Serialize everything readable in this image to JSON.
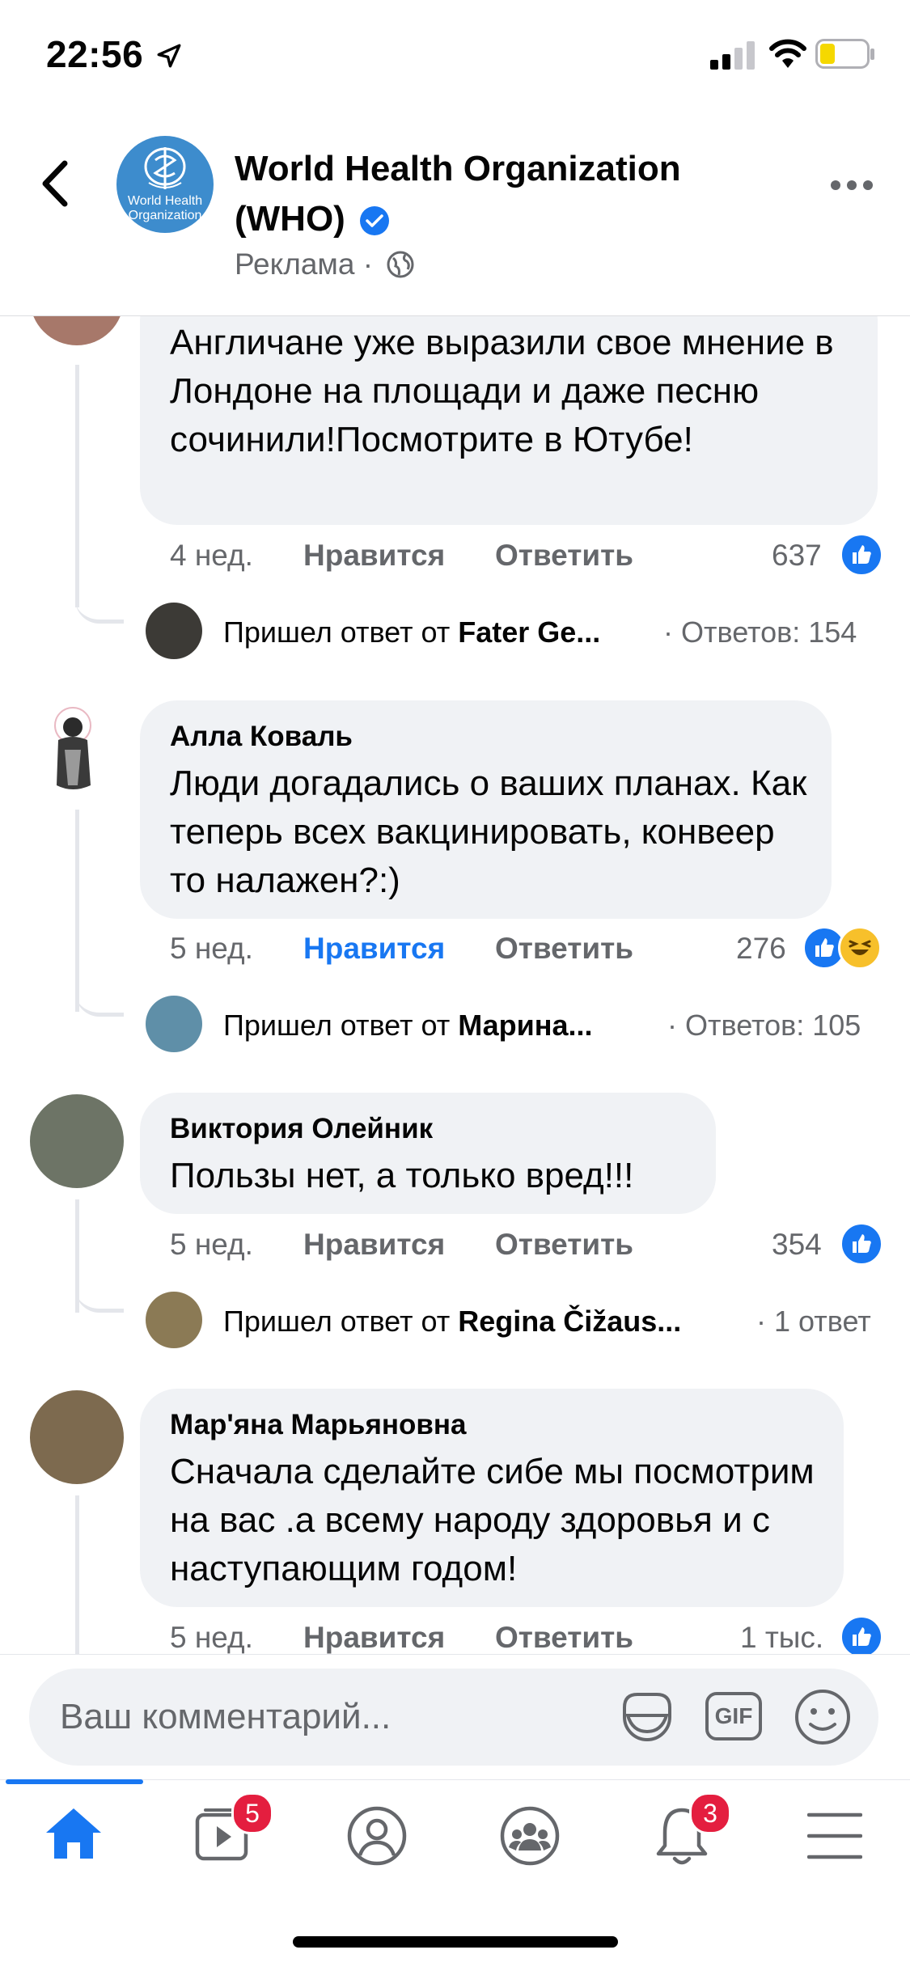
{
  "status_bar": {
    "time": "22:56"
  },
  "header": {
    "page_name": "World Health Organization (WHO)",
    "logo_text": "World Health Organization",
    "subtitle": "Реклама ·"
  },
  "comments": [
    {
      "author": "",
      "text": "Англичане уже выразили свое мнение в Лондоне на площади и даже песню сочинили!Посмотрите в Ютубе!",
      "time": "4 нед.",
      "like": "Нравится",
      "reply": "Ответить",
      "reaction_count": "637",
      "reply_prefix": "Пришел ответ от",
      "reply_author": "Fater Ge...",
      "reply_count": "· Ответов: 154"
    },
    {
      "author": "Алла Коваль",
      "text": "Люди догадались о ваших планах. Как теперь всех вакцинировать, конвеер то налажен?:)",
      "time": "5 нед.",
      "like": "Нравится",
      "reply": "Ответить",
      "reaction_count": "276",
      "reply_prefix": "Пришел ответ от",
      "reply_author": "Марина...",
      "reply_count": "· Ответов: 105"
    },
    {
      "author": "Виктория Олейник",
      "text": "Пользы нет, а только вред!!!",
      "time": "5 нед.",
      "like": "Нравится",
      "reply": "Ответить",
      "reaction_count": "354",
      "reply_prefix": "Пришел ответ от",
      "reply_author": "Regina Čižaus...",
      "reply_count": "· 1 ответ"
    },
    {
      "author": "Мар'яна Марьяновна",
      "text": "Сначала сделайте сибе мы посмотрим на вас .а всему народу здоровья и с наступающим годом!",
      "time": "5 нед.",
      "like": "Нравится",
      "reply": "Ответить",
      "reaction_count": "1 тыс."
    }
  ],
  "composer": {
    "placeholder": "Ваш комментарий...",
    "gif_label": "GIF"
  },
  "tabbar": {
    "video_badge": "5",
    "notifications_badge": "3"
  },
  "colors": {
    "accent": "#1877f2",
    "liked_text": "#1877f2",
    "badge": "#e41e3f"
  }
}
